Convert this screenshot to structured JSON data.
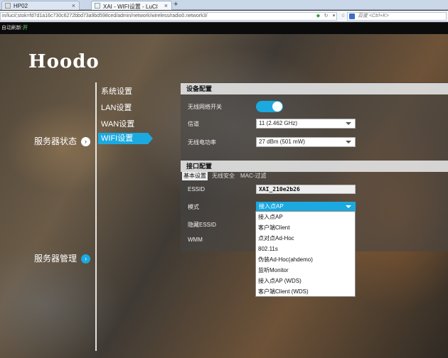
{
  "browser": {
    "tabs": [
      {
        "title": "HP02",
        "active": false
      },
      {
        "title": "XAI - WIFI设置 - LuCI",
        "active": true
      }
    ],
    "new_tab_label": "+",
    "close_label": "×",
    "url": "in/luci/;stok=fd7d1a16c730c6272bbd73a9bd598ced/admin/network/wireless/radio0.network3/",
    "search_placeholder": "百度 <Ctrl+K>"
  },
  "refresh_strip": {
    "label": "自动刷新:",
    "state": "开"
  },
  "logo": "Hoodo",
  "sections": [
    {
      "label": "服务器状态",
      "icon": "arrow-right-icon"
    },
    {
      "label": "服务器管理",
      "icon": "arrow-right-icon"
    }
  ],
  "subnav": [
    "系统设置",
    "LAN设置",
    "WAN设置",
    "WIFI设置"
  ],
  "device_config": {
    "header": "设备配置",
    "wifi_switch_label": "无线网络开关",
    "wifi_switch_on": true,
    "channel_label": "信道",
    "channel_value": "11 (2.462 GHz)",
    "power_label": "无线电功率",
    "power_value": "27 dBm (501 mW)"
  },
  "interface_config": {
    "header": "接口配置",
    "tabs": [
      "基本设置",
      "无线安全",
      "MAC-过滤"
    ],
    "essid_label": "ESSID",
    "essid_value": "XAI_210e2b26",
    "mode_label": "模式",
    "mode_value": "接入点AP",
    "hide_essid_label": "隐藏ESSID",
    "wmm_label": "WMM"
  },
  "mode_options": [
    "接入点AP",
    "客户端Client",
    "点对点Ad-Hoc",
    "802.11s",
    "伪装Ad-Hoc(ahdemo)",
    "监听Monitor",
    "接入点AP (WDS)",
    "客户端Client (WDS)"
  ],
  "colors": {
    "accent": "#1ba9e0",
    "panel_header": "#e1e1e1"
  }
}
